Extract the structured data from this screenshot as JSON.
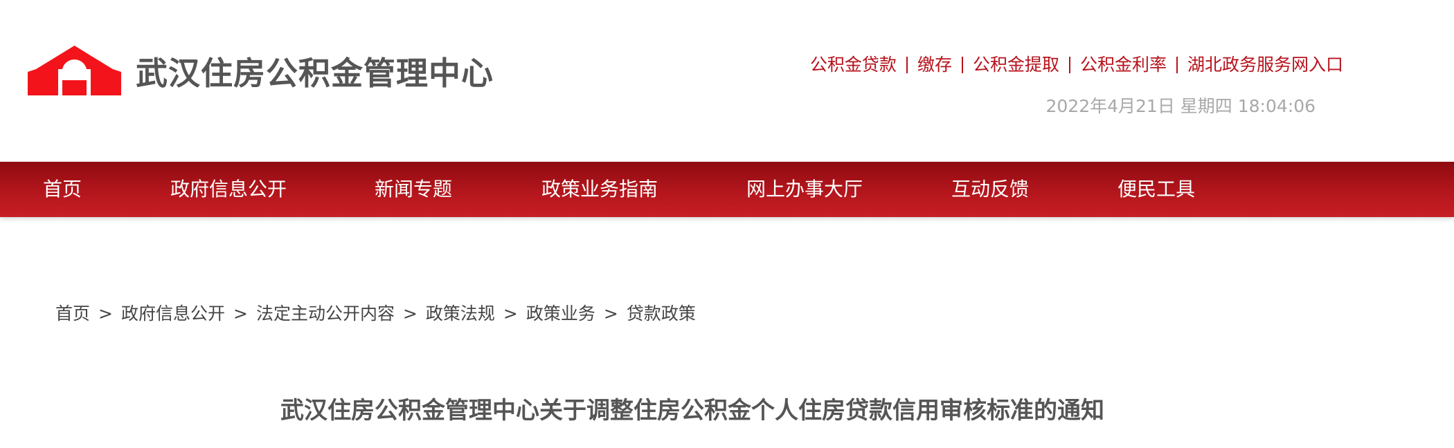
{
  "header": {
    "site_title": "武汉住房公积金管理中心",
    "quick_links": [
      {
        "label": "公积金贷款"
      },
      {
        "label": "缴存"
      },
      {
        "label": "公积金提取"
      },
      {
        "label": "公积金利率"
      },
      {
        "label": "湖北政务服务网入口"
      }
    ],
    "datetime": "2022年4月21日 星期四 18:04:06"
  },
  "nav": {
    "items": [
      {
        "label": "首页"
      },
      {
        "label": "政府信息公开"
      },
      {
        "label": "新闻专题"
      },
      {
        "label": "政策业务指南"
      },
      {
        "label": "网上办事大厅"
      },
      {
        "label": "互动反馈"
      },
      {
        "label": "便民工具"
      }
    ]
  },
  "breadcrumb": {
    "separator": ">",
    "items": [
      {
        "label": "首页"
      },
      {
        "label": "政府信息公开"
      },
      {
        "label": "法定主动公开内容"
      },
      {
        "label": "政策法规"
      },
      {
        "label": "政策业务"
      },
      {
        "label": "贷款政策"
      }
    ]
  },
  "article": {
    "title": "武汉住房公积金管理中心关于调整住房公积金个人住房贷款信用审核标准的通知"
  },
  "colors": {
    "brand_red": "#b7121b",
    "nav_red_dark": "#8e0b10",
    "nav_red_light": "#c71f24",
    "logo_red": "#f2141a",
    "title_gray": "#555555",
    "datetime_gray": "#a8a8a8"
  },
  "icons": {
    "logo": "house-roof-logo-icon"
  }
}
